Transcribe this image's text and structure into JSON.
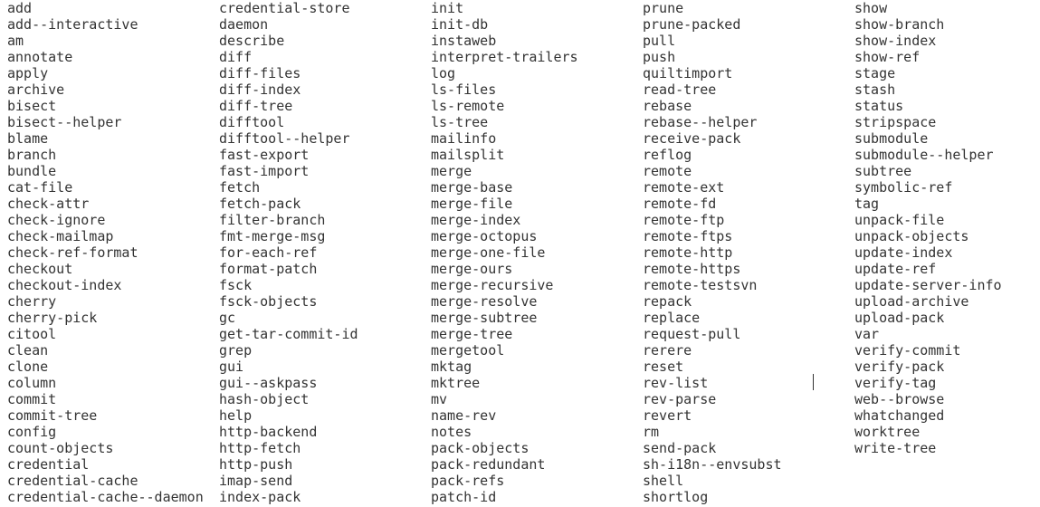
{
  "terminal": {
    "columns": [
      [
        "add",
        "add--interactive",
        "am",
        "annotate",
        "apply",
        "archive",
        "bisect",
        "bisect--helper",
        "blame",
        "branch",
        "bundle",
        "cat-file",
        "check-attr",
        "check-ignore",
        "check-mailmap",
        "check-ref-format",
        "checkout",
        "checkout-index",
        "cherry",
        "cherry-pick",
        "citool",
        "clean",
        "clone",
        "column",
        "commit",
        "commit-tree",
        "config",
        "count-objects",
        "credential",
        "credential-cache",
        "credential-cache--daemon"
      ],
      [
        "credential-store",
        "daemon",
        "describe",
        "diff",
        "diff-files",
        "diff-index",
        "diff-tree",
        "difftool",
        "difftool--helper",
        "fast-export",
        "fast-import",
        "fetch",
        "fetch-pack",
        "filter-branch",
        "fmt-merge-msg",
        "for-each-ref",
        "format-patch",
        "fsck",
        "fsck-objects",
        "gc",
        "get-tar-commit-id",
        "grep",
        "gui",
        "gui--askpass",
        "hash-object",
        "help",
        "http-backend",
        "http-fetch",
        "http-push",
        "imap-send",
        "index-pack"
      ],
      [
        "init",
        "init-db",
        "instaweb",
        "interpret-trailers",
        "log",
        "ls-files",
        "ls-remote",
        "ls-tree",
        "mailinfo",
        "mailsplit",
        "merge",
        "merge-base",
        "merge-file",
        "merge-index",
        "merge-octopus",
        "merge-one-file",
        "merge-ours",
        "merge-recursive",
        "merge-resolve",
        "merge-subtree",
        "merge-tree",
        "mergetool",
        "mktag",
        "mktree",
        "mv",
        "name-rev",
        "notes",
        "pack-objects",
        "pack-redundant",
        "pack-refs",
        "patch-id"
      ],
      [
        "prune",
        "prune-packed",
        "pull",
        "push",
        "quiltimport",
        "read-tree",
        "rebase",
        "rebase--helper",
        "receive-pack",
        "reflog",
        "remote",
        "remote-ext",
        "remote-fd",
        "remote-ftp",
        "remote-ftps",
        "remote-http",
        "remote-https",
        "remote-testsvn",
        "repack",
        "replace",
        "request-pull",
        "rerere",
        "reset",
        "rev-list",
        "rev-parse",
        "revert",
        "rm",
        "send-pack",
        "sh-i18n--envsubst",
        "shell",
        "shortlog"
      ],
      [
        "show",
        "show-branch",
        "show-index",
        "show-ref",
        "stage",
        "stash",
        "status",
        "stripspace",
        "submodule",
        "submodule--helper",
        "subtree",
        "symbolic-ref",
        "tag",
        "unpack-file",
        "unpack-objects",
        "update-index",
        "update-ref",
        "update-server-info",
        "upload-archive",
        "upload-pack",
        "var",
        "verify-commit",
        "verify-pack",
        "verify-tag",
        "web--browse",
        "whatchanged",
        "worktree",
        "write-tree"
      ]
    ]
  },
  "colors": {
    "background": "#ffffff",
    "text": "#333333"
  }
}
